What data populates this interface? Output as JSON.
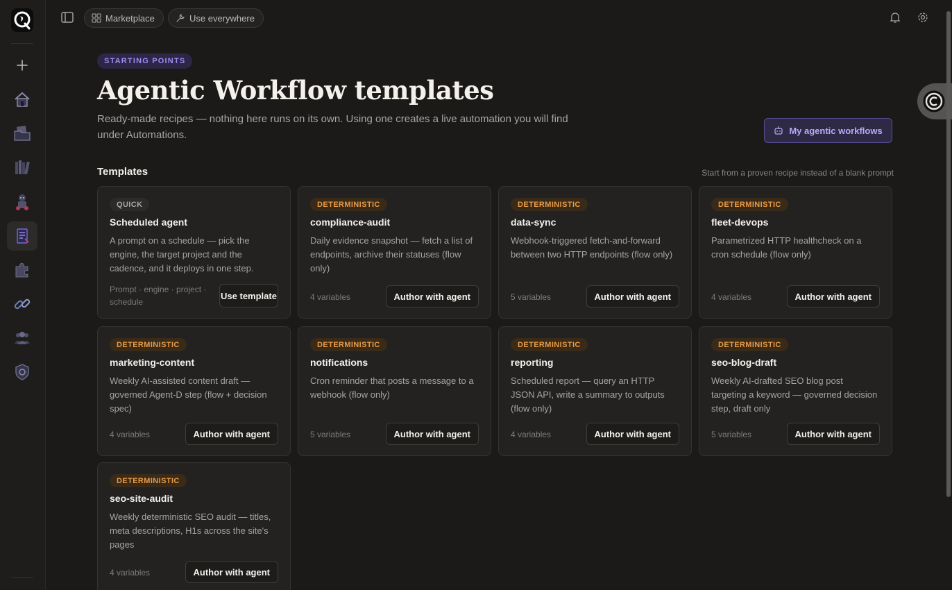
{
  "topbar": {
    "marketplace_label": "Marketplace",
    "use_everywhere_label": "Use everywhere"
  },
  "hero": {
    "badge": "STARTING POINTS",
    "title": "Agentic Workflow templates",
    "subtitle": "Ready-made recipes — nothing here runs on its own. Using one creates a live automation you will find under Automations.",
    "my_workflows_label": "My agentic workflows"
  },
  "section": {
    "title": "Templates",
    "hint": "Start from a proven recipe instead of a blank prompt"
  },
  "cards": [
    {
      "tag": "QUICK",
      "name": "Scheduled agent",
      "desc": "A prompt on a schedule — pick the engine, the target project and the cadence, and it deploys in one step.",
      "meta": "Prompt · engine · project · schedule",
      "action": "Use template"
    },
    {
      "tag": "DETERMINISTIC",
      "name": "compliance-audit",
      "desc": "Daily evidence snapshot — fetch a list of endpoints, archive their statuses (flow only)",
      "meta": "4 variables",
      "action": "Author with agent"
    },
    {
      "tag": "DETERMINISTIC",
      "name": "data-sync",
      "desc": "Webhook-triggered fetch-and-forward between two HTTP endpoints (flow only)",
      "meta": "5 variables",
      "action": "Author with agent"
    },
    {
      "tag": "DETERMINISTIC",
      "name": "fleet-devops",
      "desc": "Parametrized HTTP healthcheck on a cron schedule (flow only)",
      "meta": "4 variables",
      "action": "Author with agent"
    },
    {
      "tag": "DETERMINISTIC",
      "name": "marketing-content",
      "desc": "Weekly AI-assisted content draft — governed Agent-D step (flow + decision spec)",
      "meta": "4 variables",
      "action": "Author with agent"
    },
    {
      "tag": "DETERMINISTIC",
      "name": "notifications",
      "desc": "Cron reminder that posts a message to a webhook (flow only)",
      "meta": "5 variables",
      "action": "Author with agent"
    },
    {
      "tag": "DETERMINISTIC",
      "name": "reporting",
      "desc": "Scheduled report — query an HTTP JSON API, write a summary to outputs (flow only)",
      "meta": "4 variables",
      "action": "Author with agent"
    },
    {
      "tag": "DETERMINISTIC",
      "name": "seo-blog-draft",
      "desc": "Weekly AI-drafted SEO blog post targeting a keyword — governed decision step, draft only",
      "meta": "5 variables",
      "action": "Author with agent"
    },
    {
      "tag": "DETERMINISTIC",
      "name": "seo-site-audit",
      "desc": "Weekly deterministic SEO audit — titles, meta descriptions, H1s across the site's pages",
      "meta": "4 variables",
      "action": "Author with agent"
    }
  ],
  "colors": {
    "accent": "#a08cf0",
    "deterministic": "#e79a48",
    "background": "#1b1a19"
  }
}
